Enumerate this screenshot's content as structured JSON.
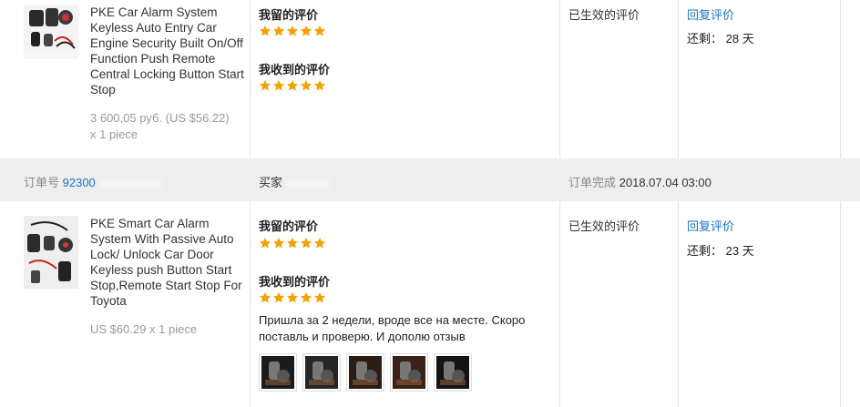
{
  "orders": [
    {
      "product_title": "PKE Car Alarm System Keyless Auto Entry Car Engine Security Built On/Off Function Push Remote Central Locking Button Start Stop",
      "price": "3 600,05 руб. (US $56.22)",
      "quantity": "x 1 piece",
      "my_feedback_label": "我留的评价",
      "received_feedback_label": "我收到的评价",
      "my_rating": 5,
      "received_rating": 5,
      "status": "已生效的评价",
      "reply_label": "回复评价",
      "remaining_label": "还剩：",
      "remaining_days": "28 天"
    },
    {
      "product_title": "PKE Smart Car Alarm System With Passive Auto Lock/ Unlock Car Door Keyless push Button Start Stop,Remote Start Stop For Toyota",
      "price": "US $60.29 x 1 piece",
      "my_feedback_label": "我留的评价",
      "received_feedback_label": "我收到的评价",
      "my_rating": 5,
      "received_rating": 5,
      "comment": "Пришла за 2 недели, вроде все на месте. Скоро поставль и проверю. И дополю отзыв",
      "photo_count": 5,
      "status": "已生效的评价",
      "reply_label": "回复评价",
      "remaining_label": "还剩：",
      "remaining_days": "23 天"
    }
  ],
  "separator": {
    "order_no_label": "订单号",
    "order_no_value": "92300",
    "buyer_label": "买家",
    "completed_label": "订单完成",
    "completed_datetime": "2018.07.04 03:00"
  },
  "colors": {
    "star": "#f5a100",
    "link": "#1a73c8",
    "separator_bg": "#eeeeee"
  }
}
